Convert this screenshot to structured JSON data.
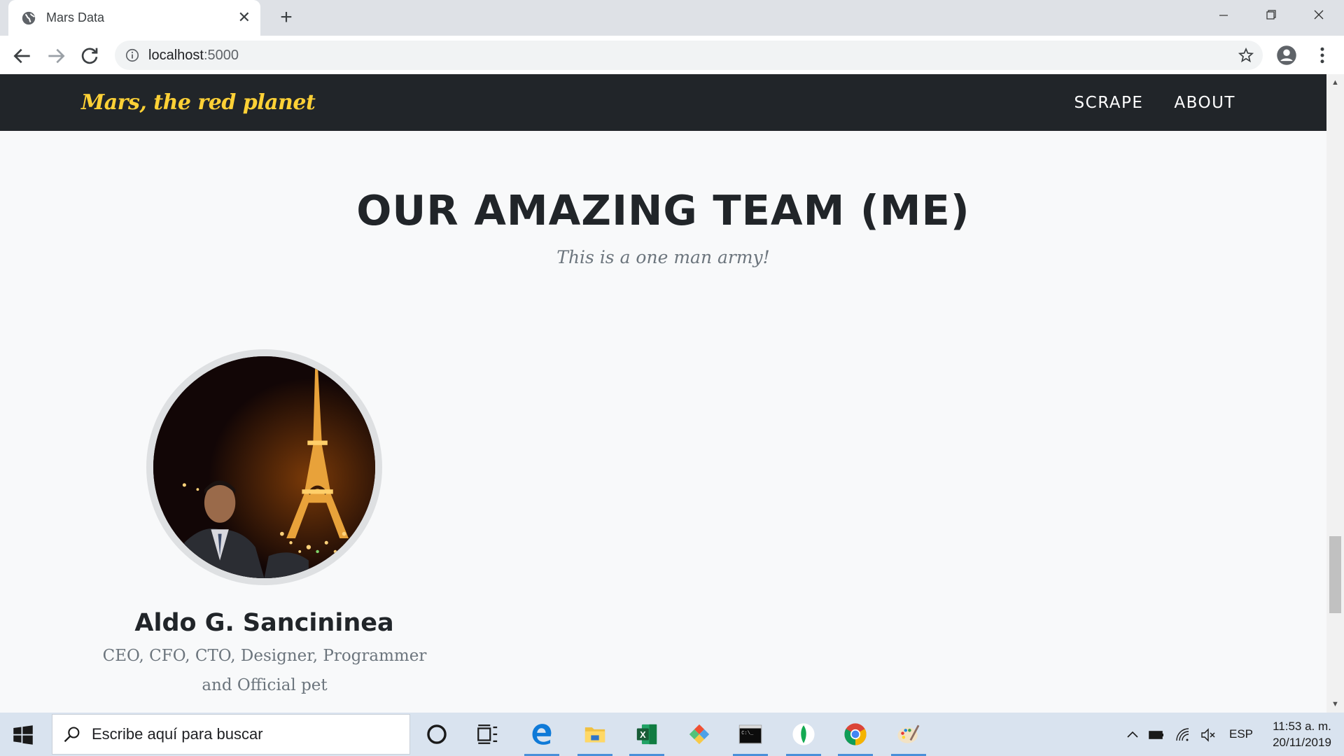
{
  "browser": {
    "tab_title": "Mars Data",
    "tab_close": "✕",
    "new_tab": "+",
    "url_host": "localhost",
    "url_port": ":5000"
  },
  "site": {
    "brand": "Mars, the red planet",
    "nav_links": [
      "SCRAPE",
      "ABOUT"
    ]
  },
  "team": {
    "heading": "OUR AMAZING TEAM (ME)",
    "subheading": "This is a one man army!",
    "member": {
      "name": "Aldo G. Sancininea",
      "role": "CEO, CFO, CTO, Designer, Programmer and Official pet"
    }
  },
  "taskbar": {
    "search_placeholder": "Escribe aquí para buscar",
    "apps": [
      "cortana-icon",
      "task-view-icon",
      "edge-icon",
      "file-explorer-icon",
      "excel-icon",
      "git-icon",
      "terminal-icon",
      "mongodb-icon",
      "chrome-icon",
      "paint-icon"
    ],
    "language": "ESP",
    "time": "11:53 a. m.",
    "date": "20/11/2019"
  },
  "colors": {
    "navbar_bg": "#212529",
    "brand": "#fed136",
    "page_bg": "#f8f9fa",
    "heading": "#212529",
    "muted": "#6c757d"
  }
}
